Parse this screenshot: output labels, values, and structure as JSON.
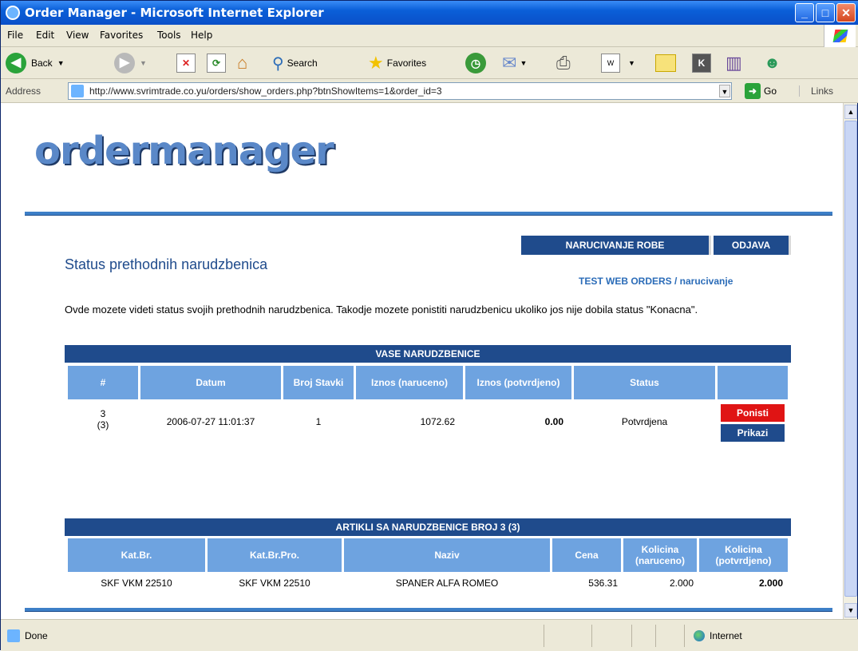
{
  "window": {
    "title": "Order Manager - Microsoft Internet Explorer"
  },
  "menu": [
    "File",
    "Edit",
    "View",
    "Favorites",
    "Tools",
    "Help"
  ],
  "toolbar": {
    "back": "Back",
    "search": "Search",
    "favorites": "Favorites"
  },
  "address": {
    "label": "Address",
    "url": "http://www.svrimtrade.co.yu/orders/show_orders.php?btnShowItems=1&order_id=3",
    "go": "Go",
    "links": "Links"
  },
  "page": {
    "logo": "ordermanager",
    "nav": {
      "order": "NARUCIVANJE ROBE",
      "logout": "ODJAVA"
    },
    "heading": "Status prethodnih narudzbenica",
    "breadcrumb": "TEST WEB ORDERS / narucivanje",
    "description": "Ovde mozete videti status svojih prethodnih narudzbenica. Takodje mozete ponistiti narudzbenicu ukoliko jos nije dobila status \"Konacna\".",
    "orders": {
      "title": "VASE NARUDZBENICE",
      "headers": [
        "#",
        "Datum",
        "Broj Stavki",
        "Iznos (naruceno)",
        "Iznos (potvrdjeno)",
        "Status",
        ""
      ],
      "rows": [
        {
          "id": "3",
          "id_sub": "(3)",
          "date": "2006-07-27 11:01:37",
          "items": "1",
          "amount_ordered": "1072.62",
          "amount_confirmed": "0.00",
          "status": "Potvrdjena",
          "cancel": "Ponisti",
          "show": "Prikazi"
        }
      ]
    },
    "articles": {
      "title": "ARTIKLI SA NARUDZBENICE BROJ 3 (3)",
      "headers": [
        "Kat.Br.",
        "Kat.Br.Pro.",
        "Naziv",
        "Cena",
        "Kolicina (naruceno)",
        "Kolicina (potvrdjeno)"
      ],
      "rows": [
        {
          "kat": "SKF VKM 22510",
          "katpro": "SKF VKM 22510",
          "name": "SPANER ALFA ROMEO",
          "price": "536.31",
          "qty_ordered": "2.000",
          "qty_confirmed": "2.000"
        }
      ]
    }
  },
  "status": {
    "text": "Done",
    "zone": "Internet"
  }
}
